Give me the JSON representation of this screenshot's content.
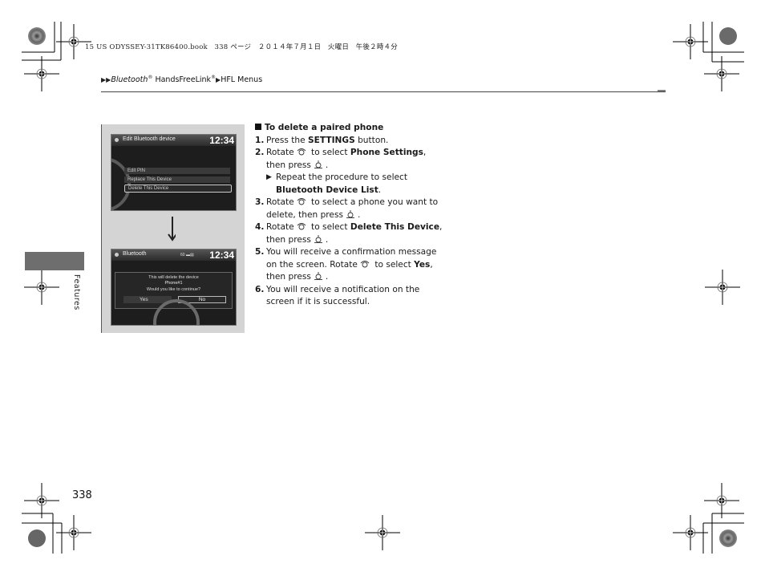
{
  "print_header": "15 US ODYSSEY-31TK86400.book　338 ページ　２０１４年７月１日　火曜日　午後２時４分",
  "breadcrumb": {
    "part1": "Bluetooth",
    "reg1": "®",
    "part2": " HandsFreeLink",
    "reg2": "®",
    "part3": "HFL Menus"
  },
  "side_tab_label": "Features",
  "page_number": "338",
  "screen1": {
    "title": "Edit Bluetooth device",
    "clock": "12:34",
    "items": [
      "Edit PIN",
      "Replace This Device",
      "Delete This Device"
    ],
    "selected_index": 2
  },
  "screen2": {
    "title": "Bluetooth",
    "status": "60 ▬▤",
    "clock": "12:34",
    "message_line1": "This will delete the device",
    "message_line2": "Phone#1",
    "message_line3": "Would you like to continue?",
    "yes_label": "Yes",
    "no_label": "No"
  },
  "instructions": {
    "heading": "To delete a paired phone",
    "steps": [
      {
        "num": "1.",
        "pre": "Press the ",
        "bold": "SETTINGS",
        "post": " button."
      },
      {
        "num": "2.",
        "pre": "Rotate",
        "mid": " to select ",
        "bold": "Phone Settings",
        "post": ", then press",
        "end": "."
      },
      {
        "sub_pre": "Repeat the procedure to select ",
        "sub_bold": "Bluetooth Device List",
        "sub_end": "."
      },
      {
        "num": "3.",
        "pre": "Rotate",
        "mid": " to select a phone you want to delete, then press",
        "end": "."
      },
      {
        "num": "4.",
        "pre": "Rotate",
        "mid": " to select ",
        "bold": "Delete This Device",
        "post": ", then press",
        "end": "."
      },
      {
        "num": "5.",
        "pre": "You will receive a confirmation message on the screen. Rotate",
        "mid": " to select ",
        "bold": "Yes",
        "post": ", then press",
        "end": "."
      },
      {
        "num": "6.",
        "pre": "You will receive a notification on the screen if it is successful."
      }
    ]
  },
  "icons": {
    "rotate": "interface-dial-rotate-icon",
    "press": "interface-dial-press-icon"
  }
}
